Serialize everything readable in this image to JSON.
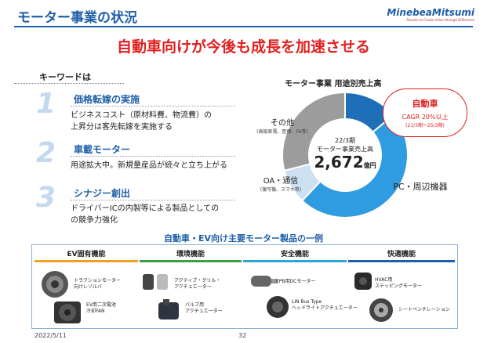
{
  "header": {
    "title": "モーター事業の状況",
    "brand": "MinebeaMitsumi",
    "brand_sub": "Passion to Create Value through Difference"
  },
  "headline": "自動車向けが今後も成長を加速させる",
  "keywords_label": "キーワードは",
  "keywords": [
    {
      "num": "1",
      "title": "価格転嫁の実施",
      "body": [
        "ビジネスコスト（原材料費、物流費）の",
        "上昇分は客先転嫁を実施する"
      ]
    },
    {
      "num": "2",
      "title": "車載モーター",
      "body": [
        "用途拡大中。新規量産品が続々と立ち上がる"
      ]
    },
    {
      "num": "3",
      "title": "シナジー創出",
      "body": [
        "ドライバーICの内製等による製品としての",
        "の競争力強化"
      ]
    }
  ],
  "chart_data": {
    "type": "pie",
    "title": "モーター事業 用途別売上高",
    "center": {
      "line1": "22/3期",
      "line2": "モーター事業売上高",
      "value": "2,672",
      "unit": "億円"
    },
    "slices": [
      {
        "label": "自動車",
        "value": 14,
        "color": "#1f6fb8"
      },
      {
        "label": "PC・周辺機器",
        "value": 48,
        "color": "#2f9be0"
      },
      {
        "label": "OA・通信",
        "sub": "(複写機、スマホ等)",
        "value": 9,
        "color": "#cce0f2"
      },
      {
        "label": "その他",
        "sub": "(高級家電、医療、FA等)",
        "value": 29,
        "color": "#9c9c9c"
      }
    ]
  },
  "callout": {
    "title": "自動車",
    "sub": "CAGR 20%以上",
    "note": "(21/3期～25/3期)"
  },
  "products": {
    "title": "自動車・EV向け主要モーター製品の一例",
    "categories": [
      {
        "label": "EV固有機能",
        "color": "#f0a020"
      },
      {
        "label": "環境機能",
        "color": "#3aa048"
      },
      {
        "label": "安全機能",
        "color": "#2aa6d6"
      },
      {
        "label": "快適機能",
        "color": "#1f5fa8"
      }
    ],
    "items": [
      {
        "label": "トラクションモーター\n向けレゾルバ"
      },
      {
        "label": "EV用二次電池\n冷却FAN"
      },
      {
        "label": "アクティブ・グリル・\nアクチュエーター"
      },
      {
        "label": "バルブ用\nアクチュエーター"
      },
      {
        "label": "EPB用DCモーター"
      },
      {
        "label": "LIN Bus Type\nヘッドライトアクチュエーター"
      },
      {
        "label": "HVAC用\nステッピングモーター"
      },
      {
        "label": "シートベンチレーション"
      }
    ]
  },
  "footer": {
    "date": "2022/5/11",
    "page": "32"
  }
}
